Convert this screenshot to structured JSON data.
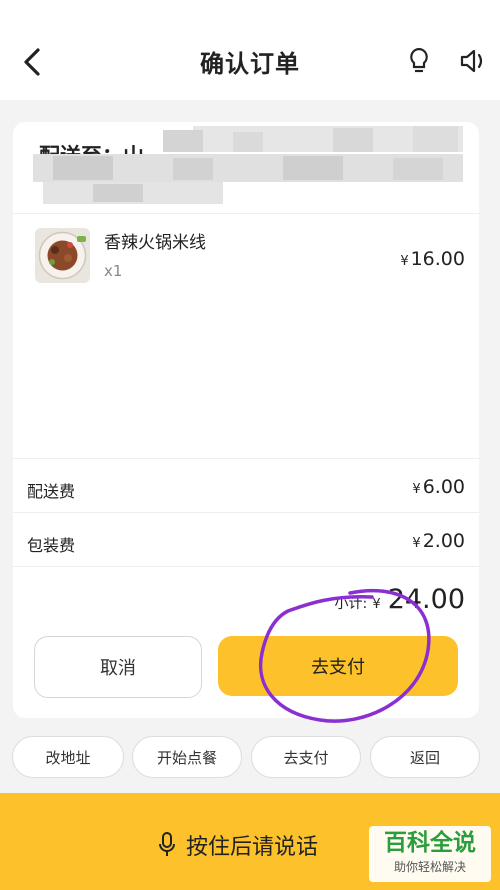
{
  "header": {
    "title": "确认订单",
    "back_icon": "back-arrow-icon",
    "hint_icon": "lightbulb-icon",
    "sound_icon": "speaker-icon"
  },
  "address": {
    "label": "配送至：山"
  },
  "item": {
    "name": "香辣火锅米线",
    "qty": "x1",
    "price": "16.00",
    "currency": "¥"
  },
  "fees": [
    {
      "label": "配送费",
      "value": "6.00"
    },
    {
      "label": "包装费",
      "value": "2.00"
    }
  ],
  "subtotal": {
    "label": "小计:",
    "currency": "¥",
    "value": "24.00"
  },
  "buttons": {
    "cancel": "取消",
    "pay": "去支付"
  },
  "chips": [
    "改地址",
    "开始点餐",
    "去支付",
    "返回"
  ],
  "voice": {
    "label": "按住后请说话",
    "icon": "microphone-icon"
  },
  "watermark": {
    "main": "百科全说",
    "sub": "助你轻松解决"
  },
  "colors": {
    "accent": "#fdc22b",
    "annotation": "#8b2fd0",
    "watermark": "#2a9d3c"
  }
}
